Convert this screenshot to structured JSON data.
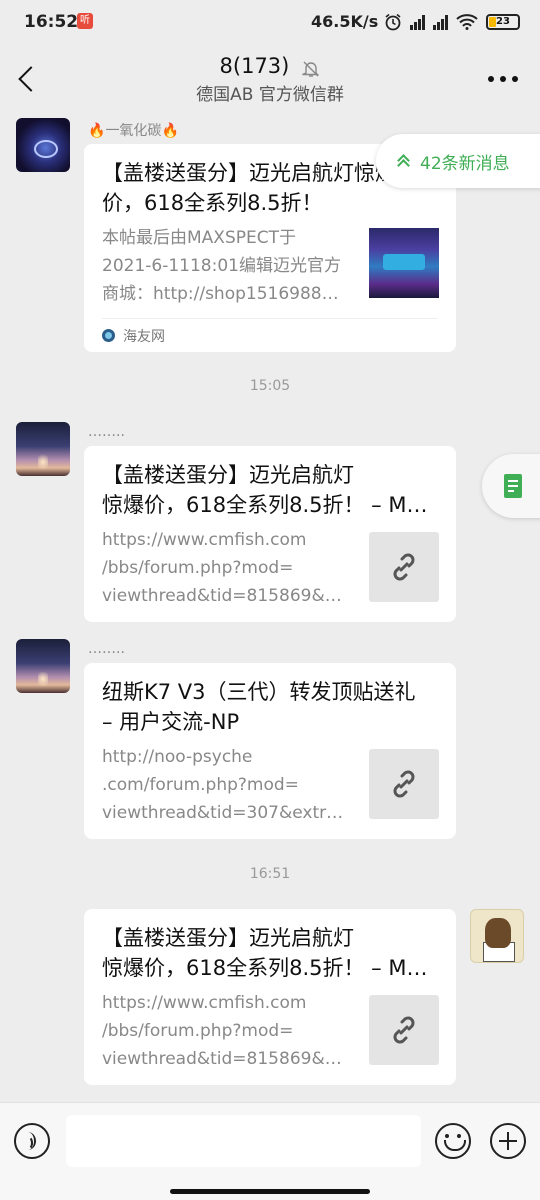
{
  "status_bar": {
    "time": "16:52",
    "notification_badge": "听",
    "net_speed": "46.5K/s",
    "battery": "23",
    "icons": [
      "alarm-icon",
      "hd-signal-icon",
      "hd-signal-icon",
      "wifi-icon",
      "battery-icon"
    ]
  },
  "header": {
    "title": "8(173)",
    "subtitle": "德国AB  官方微信群",
    "muted": true
  },
  "new_messages_pill": "42条新消息",
  "messages": [
    {
      "sender": "一氧化碳",
      "sender_emoji": "🔥",
      "title": "【盖楼送蛋分】迈光启航灯惊爆价，618全系列8.5折！",
      "title_lines": [
        "【盖楼送蛋分】迈光启航灯惊爆",
        "价，618全系列8.5折！"
      ],
      "desc_lines": [
        "本帖最后由MAXSPECT于",
        "2021-6-1118:01编辑迈光官方",
        "商城：http://shop1516988…"
      ],
      "source": "海友网"
    },
    {
      "timestamp": "15:05"
    },
    {
      "sender": "……..",
      "title_lines": [
        "【盖楼送蛋分】迈光启航灯",
        "惊爆价，618全系列8.5折！ – M…"
      ],
      "desc_lines": [
        "https://www.cmfish.com",
        "/bbs/forum.php?mod=",
        "viewthread&tid=815869&…"
      ]
    },
    {
      "sender": "……..",
      "title_lines": [
        "纽斯K7 V3（三代）转发顶贴送礼",
        "– 用户交流-NP"
      ],
      "desc_lines": [
        "http://noo-psyche",
        ".com/forum.php?mod=",
        "viewthread&tid=307&extr…"
      ]
    },
    {
      "timestamp": "16:51"
    },
    {
      "title_lines": [
        "【盖楼送蛋分】迈光启航灯",
        "惊爆价，618全系列8.5折！ – M…"
      ],
      "desc_lines": [
        "https://www.cmfish.com",
        "/bbs/forum.php?mod=",
        "viewthread&tid=815869&…"
      ]
    }
  ],
  "input_bar": {
    "placeholder": ""
  },
  "colors": {
    "background": "#ededed",
    "accent_green": "#3fae55",
    "card": "#ffffff"
  }
}
